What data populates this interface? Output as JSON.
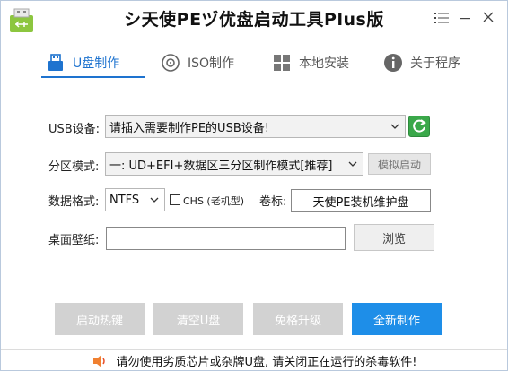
{
  "window": {
    "title": "シ天使PEヅ优盘启动工具Plus版"
  },
  "nav": {
    "tabs": [
      {
        "label": "U盘制作",
        "icon": "usb-drive-icon",
        "active": true
      },
      {
        "label": "ISO制作",
        "icon": "disc-icon",
        "active": false
      },
      {
        "label": "本地安装",
        "icon": "windows-logo-icon",
        "active": false
      },
      {
        "label": "关于程序",
        "icon": "info-icon",
        "active": false
      }
    ]
  },
  "form": {
    "usb_device": {
      "label": "USB设备:",
      "value": "请插入需要制作PE的USB设备!"
    },
    "partition_mode": {
      "label": "分区模式:",
      "value": "一: UD+EFI+数据区三分区制作模式[推荐]",
      "simulate_button": "模拟启动"
    },
    "data_format": {
      "label": "数据格式:",
      "value": "NTFS",
      "chs_label": "CHS (老机型)",
      "chs_checked": false,
      "volume_label": "卷标:",
      "volume_value": "天使PE装机维护盘"
    },
    "wallpaper": {
      "label": "桌面壁纸:",
      "value": "",
      "browse_button": "浏览"
    }
  },
  "actions": {
    "hotkey": "启动热键",
    "clear_usb": "清空U盘",
    "upgrade": "免格升级",
    "new_build": "全新制作"
  },
  "footer": {
    "message": "请勿使用劣质芯片或杂牌U盘, 请关闭正在运行的杀毒软件!"
  },
  "colors": {
    "accent": "#1e73cf",
    "primary_button": "#1e8ee8",
    "disabled_button": "#d2d2d2",
    "refresh_green": "#3aa84a"
  }
}
